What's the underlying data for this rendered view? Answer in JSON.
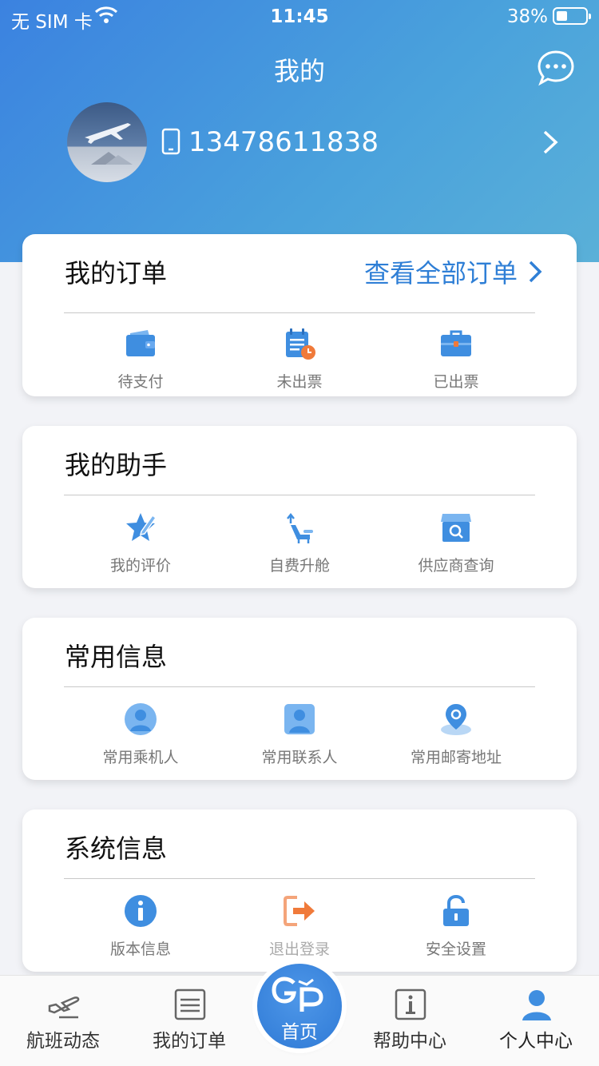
{
  "status_bar": {
    "carrier": "无 SIM 卡",
    "time": "11:45",
    "battery_pct": "38%"
  },
  "header": {
    "title": "我的",
    "phone": "13478611838"
  },
  "orders": {
    "title": "我的订单",
    "link": "查看全部订单",
    "items": [
      {
        "label": "待支付",
        "icon": "wallet-icon"
      },
      {
        "label": "未出票",
        "icon": "pending-ticket-icon"
      },
      {
        "label": "已出票",
        "icon": "briefcase-icon"
      }
    ]
  },
  "assistant": {
    "title": "我的助手",
    "items": [
      {
        "label": "我的评价",
        "icon": "star-pen-icon"
      },
      {
        "label": "自费升舱",
        "icon": "seat-upgrade-icon"
      },
      {
        "label": "供应商查询",
        "icon": "store-search-icon"
      }
    ]
  },
  "common": {
    "title": "常用信息",
    "items": [
      {
        "label": "常用乘机人",
        "icon": "passenger-icon"
      },
      {
        "label": "常用联系人",
        "icon": "contact-icon"
      },
      {
        "label": "常用邮寄地址",
        "icon": "location-icon"
      }
    ]
  },
  "system": {
    "title": "系统信息",
    "items": [
      {
        "label": "版本信息",
        "icon": "info-icon"
      },
      {
        "label": "退出登录",
        "icon": "logout-icon"
      },
      {
        "label": "安全设置",
        "icon": "unlock-icon"
      }
    ]
  },
  "tabbar": {
    "tabs": [
      {
        "label": "航班动态"
      },
      {
        "label": "我的订单"
      },
      {
        "label": "首页"
      },
      {
        "label": "帮助中心"
      },
      {
        "label": "个人中心"
      }
    ]
  },
  "colors": {
    "accent": "#2f7fd6",
    "orange": "#f07a3a"
  }
}
